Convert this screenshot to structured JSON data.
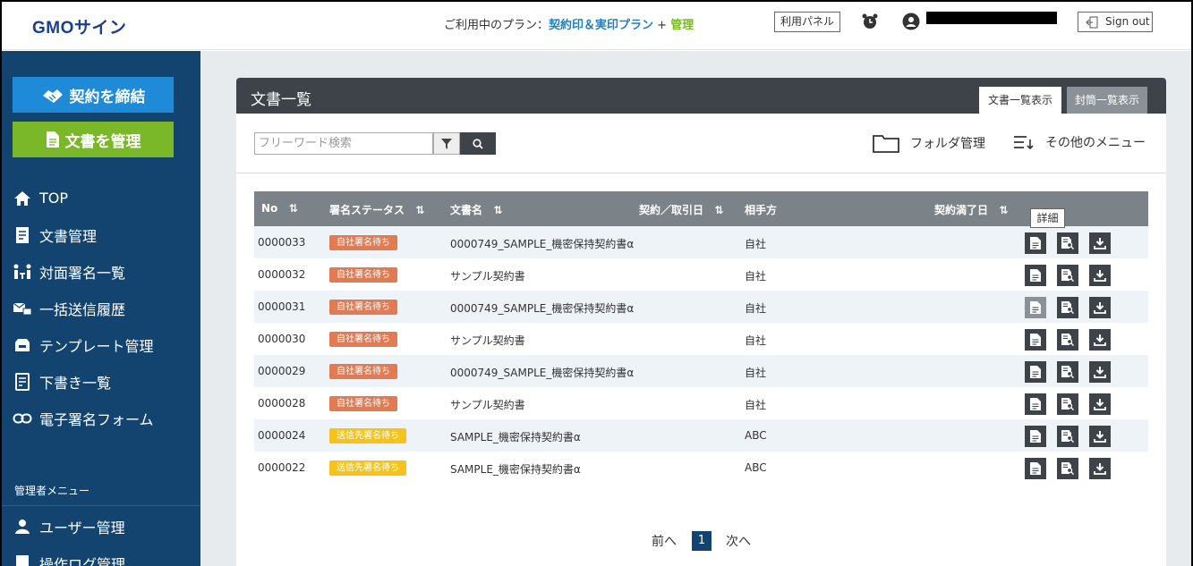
{
  "header": {
    "logo": "GMOサイン",
    "plan_prefix": "ご利用中のプラン：",
    "plan_name": "契約印＆実印プラン",
    "plan_plus": " + ",
    "plan_admin": "管理",
    "panel_btn": "利用パネル",
    "signout": "Sign out"
  },
  "sidebar": {
    "contract_btn": "契約を締結",
    "docs_btn": "文書を管理",
    "items": [
      {
        "label": "TOP",
        "icon": "home-icon"
      },
      {
        "label": "文書管理",
        "icon": "document-icon"
      },
      {
        "label": "対面署名一覧",
        "icon": "face-sign-icon"
      },
      {
        "label": "一括送信履歴",
        "icon": "bulk-send-icon"
      },
      {
        "label": "テンプレート管理",
        "icon": "template-icon"
      },
      {
        "label": "下書き一覧",
        "icon": "draft-icon"
      },
      {
        "label": "電子署名フォーム",
        "icon": "link-icon"
      }
    ],
    "admin_title": "管理者メニュー",
    "admin_items": [
      {
        "label": "ユーザー管理",
        "icon": "user-icon"
      },
      {
        "label": "操作ログ管理",
        "icon": "log-icon"
      }
    ]
  },
  "main": {
    "title": "文書一覧",
    "tab_active": "文書一覧表示",
    "tab_inactive": "封筒一覧表示",
    "search_placeholder": "フリーワード検索",
    "folder_label": "フォルダ管理",
    "menu_label": "その他のメニュー",
    "tooltip": "詳細"
  },
  "table": {
    "headers": [
      "No",
      "署名ステータス",
      "文書名",
      "契約／取引日",
      "相手方",
      "契約満了日"
    ],
    "rows": [
      {
        "no": "0000033",
        "status": "自社署名待ち",
        "status_type": "self",
        "name": "0000749_SAMPLE_機密保持契約書α",
        "party": "自社"
      },
      {
        "no": "0000032",
        "status": "自社署名待ち",
        "status_type": "self",
        "name": "サンプル契約書",
        "party": "自社"
      },
      {
        "no": "0000031",
        "status": "自社署名待ち",
        "status_type": "self",
        "name": "0000749_SAMPLE_機密保持契約書α",
        "party": "自社"
      },
      {
        "no": "0000030",
        "status": "自社署名待ち",
        "status_type": "self",
        "name": "サンプル契約書",
        "party": "自社"
      },
      {
        "no": "0000029",
        "status": "自社署名待ち",
        "status_type": "self",
        "name": "0000749_SAMPLE_機密保持契約書α",
        "party": "自社"
      },
      {
        "no": "0000028",
        "status": "自社署名待ち",
        "status_type": "self",
        "name": "サンプル契約書",
        "party": "自社"
      },
      {
        "no": "0000024",
        "status": "送信先署名待ち",
        "status_type": "other",
        "name": "SAMPLE_機密保持契約書α",
        "party": "ABC"
      },
      {
        "no": "0000022",
        "status": "送信先署名待ち",
        "status_type": "other",
        "name": "SAMPLE_機密保持契約書α",
        "party": "ABC"
      }
    ]
  },
  "pager": {
    "prev": "前へ",
    "current": "1",
    "next": "次へ"
  },
  "colors": {
    "sidebar_bg": "#134470",
    "contract_btn": "#1f8ad8",
    "docs_btn": "#7ab829",
    "badge_self": "#e07b53",
    "badge_other": "#f5c31b"
  }
}
